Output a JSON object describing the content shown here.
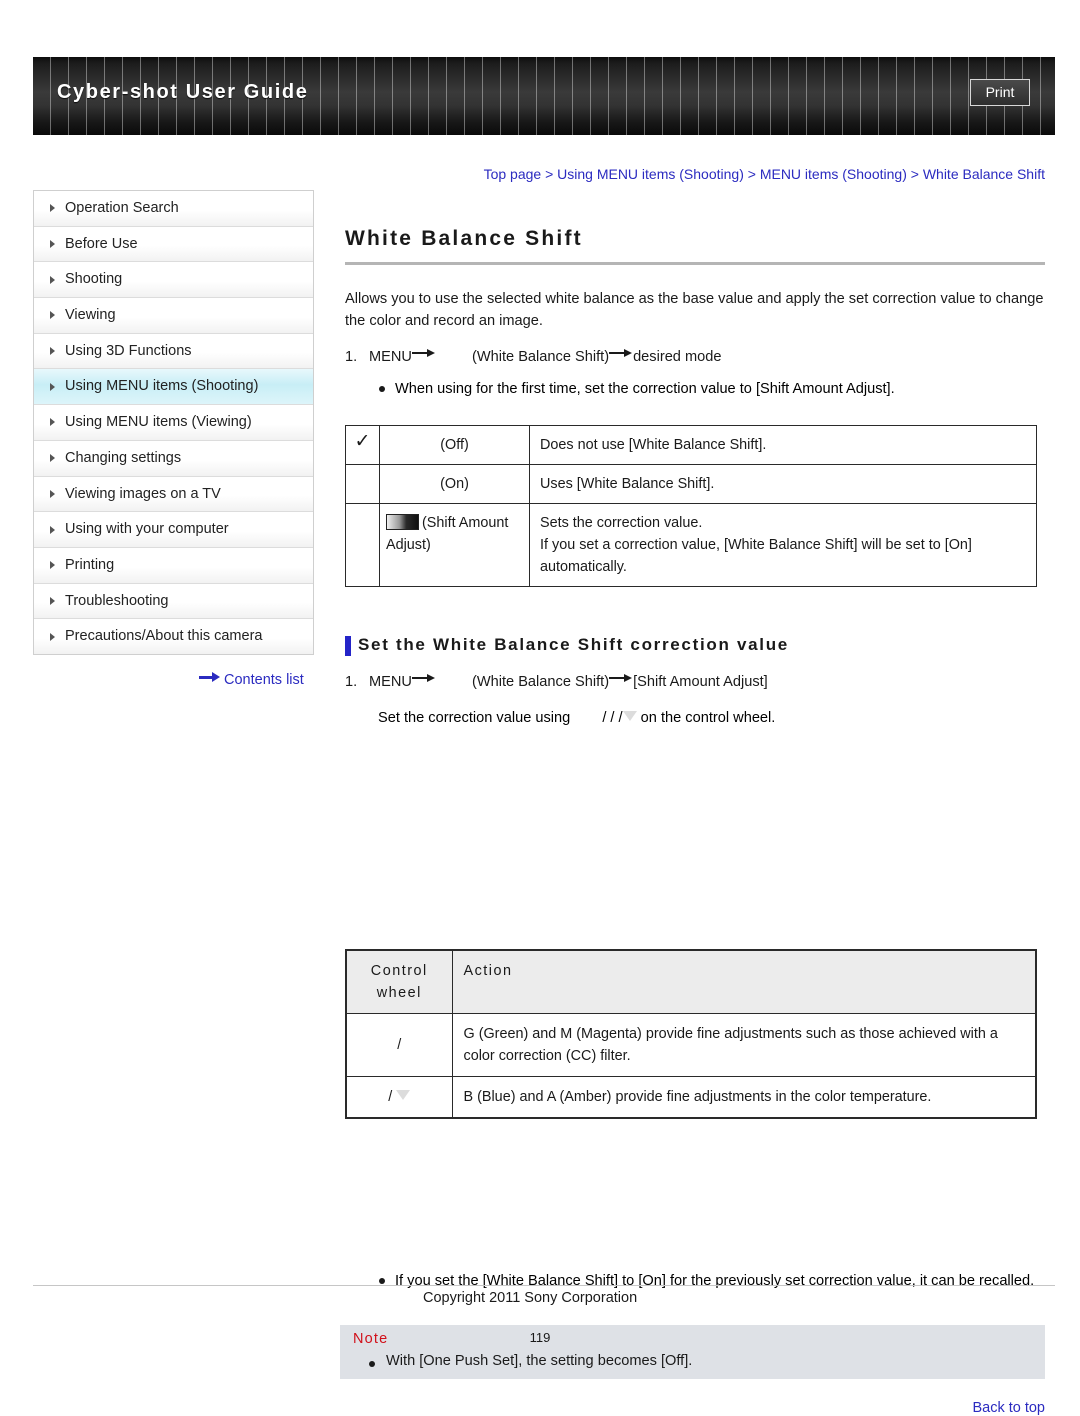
{
  "header": {
    "title": "Cyber-shot User Guide",
    "print_label": "Print"
  },
  "sidebar": {
    "items": [
      {
        "label": "Operation Search",
        "active": false
      },
      {
        "label": "Before Use",
        "active": false
      },
      {
        "label": "Shooting",
        "active": false
      },
      {
        "label": "Viewing",
        "active": false
      },
      {
        "label": "Using 3D Functions",
        "active": false
      },
      {
        "label": "Using MENU items (Shooting)",
        "active": true
      },
      {
        "label": "Using MENU items (Viewing)",
        "active": false
      },
      {
        "label": "Changing settings",
        "active": false
      },
      {
        "label": "Viewing images on a TV",
        "active": false
      },
      {
        "label": "Using with your computer",
        "active": false
      },
      {
        "label": "Printing",
        "active": false
      },
      {
        "label": "Troubleshooting",
        "active": false
      },
      {
        "label": "Precautions/About this camera",
        "active": false
      }
    ],
    "contents_list_label": "Contents list"
  },
  "main": {
    "breadcrumb": "Top page > Using MENU items (Shooting) > MENU items (Shooting) > White Balance Shift",
    "page_title": "White Balance Shift",
    "intro": "Allows you to use the selected white balance as the base value and apply the set correction value to change the color and record an image.",
    "step1": {
      "number": "1.",
      "menu_label": "MENU",
      "target": "(White Balance Shift)",
      "result": "desired mode"
    },
    "step1_note": "When using for the first time, set the correction value to [Shift Amount Adjust].",
    "modes_table": {
      "rows": [
        {
          "check": "✓",
          "mode": "(Off)",
          "icon": false,
          "desc": "Does not use [White Balance Shift]."
        },
        {
          "check": "",
          "mode": "(On)",
          "icon": false,
          "desc": "Uses [White Balance Shift]."
        },
        {
          "check": "",
          "mode": "(Shift Amount Adjust)",
          "icon": true,
          "desc": "Sets the correction value.\nIf you set a correction value, [White Balance Shift] will be set to [On] automatically."
        }
      ]
    },
    "section_heading": "Set the White Balance Shift correction value",
    "step2": {
      "number": "1.",
      "menu_label": "MENU",
      "target": "(White Balance Shift)",
      "result": "[Shift Amount Adjust]"
    },
    "step2_detail_prefix": "Set the correction value using",
    "step2_slashes": "/   /   /",
    "step2_detail_suffix": "on the control wheel.",
    "wheel_table": {
      "headers": [
        "Control wheel",
        "Action"
      ],
      "rows": [
        {
          "wheel": "/",
          "has_triangle": false,
          "action": "G (Green) and M (Magenta) provide fine adjustments such as those achieved with a color correction (CC) filter."
        },
        {
          "wheel": "/",
          "has_triangle": true,
          "action": "B (Blue) and A (Amber) provide fine adjustments in the color temperature."
        }
      ]
    },
    "post_note": "If you set the [White Balance Shift] to [On] for the previously set correction value, it can be recalled.",
    "note": {
      "title": "Note",
      "body": "With [One Push Set], the setting becomes [Off]."
    },
    "back_to_top": "Back to top"
  },
  "footer": {
    "copyright": "Copyright 2011 Sony Corporation",
    "page_number": "119"
  },
  "colors": {
    "link": "#2b2bc0",
    "accent_bar": "#2424c8",
    "note_title": "#d1101a",
    "sidebar_active": "#c8eef6"
  }
}
